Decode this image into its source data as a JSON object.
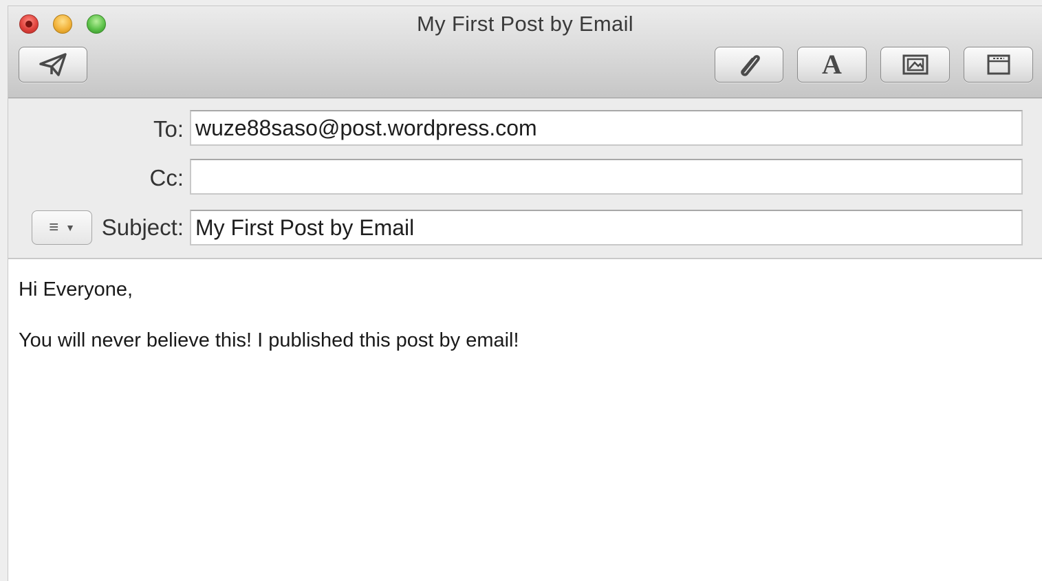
{
  "window": {
    "title": "My First Post by Email"
  },
  "toolbar": {
    "send_icon": "paper-plane-icon",
    "attach_icon": "paperclip-icon",
    "fonts_glyph": "A",
    "photo_icon": "photo-browser-icon",
    "stationery_icon": "stationery-icon"
  },
  "headers": {
    "to_label": "To:",
    "to_value": "wuze88saso@post.wordpress.com",
    "cc_label": "Cc:",
    "cc_value": "",
    "subject_label": "Subject:",
    "subject_value": "My First Post by Email",
    "format_menu_icon": "list-menu-icon"
  },
  "message": {
    "greeting": "Hi Everyone,",
    "line1": "You will never believe this! I published this post by email!"
  }
}
